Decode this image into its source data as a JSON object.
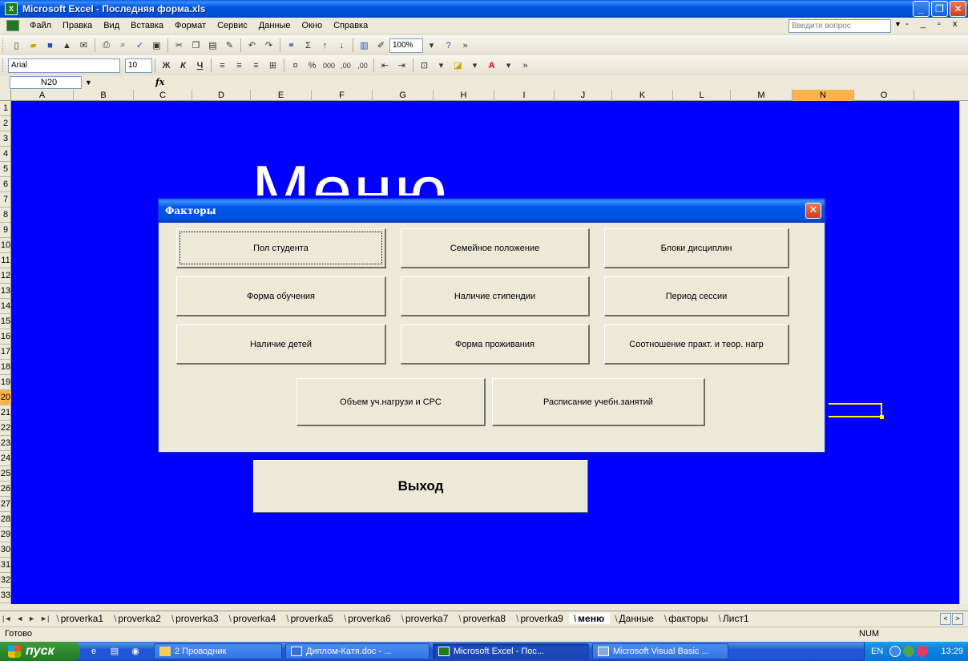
{
  "window": {
    "title": "Microsoft Excel - Последняя форма.xls",
    "buttons": {
      "minimize": "_",
      "restore": "❐",
      "close": "✕"
    }
  },
  "menubar": {
    "items": [
      "Файл",
      "Правка",
      "Вид",
      "Вставка",
      "Формат",
      "Сервис",
      "Данные",
      "Окно",
      "Справка"
    ],
    "ask_placeholder": "Введите вопрос",
    "doc_controls": "- _ ▫ x"
  },
  "toolbar": {
    "zoom": "100%",
    "font": "Arial",
    "font_size": "10",
    "bold": "Ж",
    "italic": "К",
    "underline": "Ч",
    "percent": "%",
    "thousands": "000",
    "inc_decimal": ",00",
    "dec_decimal": ",00",
    "sigma": "Σ",
    "font_color_letter": "A"
  },
  "formula_bar": {
    "name_box": "N20",
    "fx": "fx",
    "value": ""
  },
  "grid": {
    "columns": [
      "A",
      "B",
      "C",
      "D",
      "E",
      "F",
      "G",
      "H",
      "I",
      "J",
      "K",
      "L",
      "M",
      "N",
      "O"
    ],
    "active_column": "N",
    "rows": [
      "1",
      "2",
      "3",
      "4",
      "5",
      "6",
      "7",
      "8",
      "9",
      "10",
      "11",
      "12",
      "13",
      "14",
      "15",
      "16",
      "17",
      "18",
      "19",
      "20",
      "21",
      "22",
      "23",
      "24",
      "25",
      "26",
      "27",
      "28",
      "29",
      "30",
      "31",
      "32",
      "33"
    ],
    "active_row": "20",
    "sheet_bg": "#0000ff"
  },
  "sheet": {
    "big_title": "Меню",
    "exit_label": "Выход"
  },
  "dialog": {
    "title": "Факторы",
    "close": "✕",
    "buttons": {
      "gender": "Пол студента",
      "family": "Семейное положение",
      "blocks": "Блоки дисциплин",
      "study_form": "Форма обучения",
      "scholarship": "Наличие стипендии",
      "session": "Период сессии",
      "children": "Наличие детей",
      "residence": "Форма проживания",
      "ratio": "Соотношение практ. и теор. нагр",
      "load": "Объем уч.нагрузи и СРС",
      "schedule": "Расписание учебн.занятий"
    }
  },
  "sheet_tabs": {
    "nav": [
      "|◄",
      "◄",
      "►",
      "►|"
    ],
    "tabs": [
      "proverka1",
      "proverka2",
      "proverka3",
      "proverka4",
      "proverka5",
      "proverka6",
      "proverka7",
      "proverka8",
      "proverka9",
      "меню",
      "Данные",
      "факторы",
      "Лист1"
    ],
    "active": "меню"
  },
  "status": {
    "ready": "Готово",
    "num": "NUM"
  },
  "taskbar": {
    "start": "пуск",
    "tasks": [
      {
        "label": "2 Проводник",
        "icon": "folder-icon"
      },
      {
        "label": "Диплом-Катя.doc - ...",
        "icon": "word-icon"
      },
      {
        "label": "Microsoft Excel - Пос...",
        "icon": "excel-icon"
      },
      {
        "label": "Microsoft Visual Basic ...",
        "icon": "vb-icon"
      }
    ],
    "lang": "EN",
    "clock": "13:29"
  }
}
